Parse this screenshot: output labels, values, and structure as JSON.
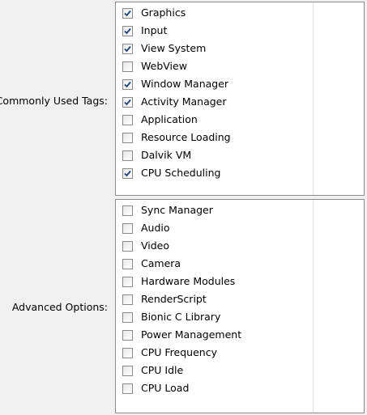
{
  "groups": [
    {
      "label": "Commonly Used Tags:",
      "items": [
        {
          "label": "Graphics",
          "checked": true
        },
        {
          "label": "Input",
          "checked": true
        },
        {
          "label": "View System",
          "checked": true
        },
        {
          "label": "WebView",
          "checked": false
        },
        {
          "label": "Window Manager",
          "checked": true
        },
        {
          "label": "Activity Manager",
          "checked": true
        },
        {
          "label": "Application",
          "checked": false
        },
        {
          "label": "Resource Loading",
          "checked": false
        },
        {
          "label": "Dalvik VM",
          "checked": false
        },
        {
          "label": "CPU Scheduling",
          "checked": true
        }
      ]
    },
    {
      "label": "Advanced Options:",
      "items": [
        {
          "label": "Sync Manager",
          "checked": false
        },
        {
          "label": "Audio",
          "checked": false
        },
        {
          "label": "Video",
          "checked": false
        },
        {
          "label": "Camera",
          "checked": false
        },
        {
          "label": "Hardware Modules",
          "checked": false
        },
        {
          "label": "RenderScript",
          "checked": false
        },
        {
          "label": "Bionic C Library",
          "checked": false
        },
        {
          "label": "Power Management",
          "checked": false
        },
        {
          "label": "CPU Frequency",
          "checked": false
        },
        {
          "label": "CPU Idle",
          "checked": false
        },
        {
          "label": "CPU Load",
          "checked": false
        }
      ]
    }
  ],
  "colors": {
    "window_bg": "#f0f0f0",
    "list_bg": "#ffffff",
    "list_border": "#8b8b8b",
    "check_mark": "#1f3f7a"
  },
  "icons": {
    "checked": "check-mark-icon"
  }
}
